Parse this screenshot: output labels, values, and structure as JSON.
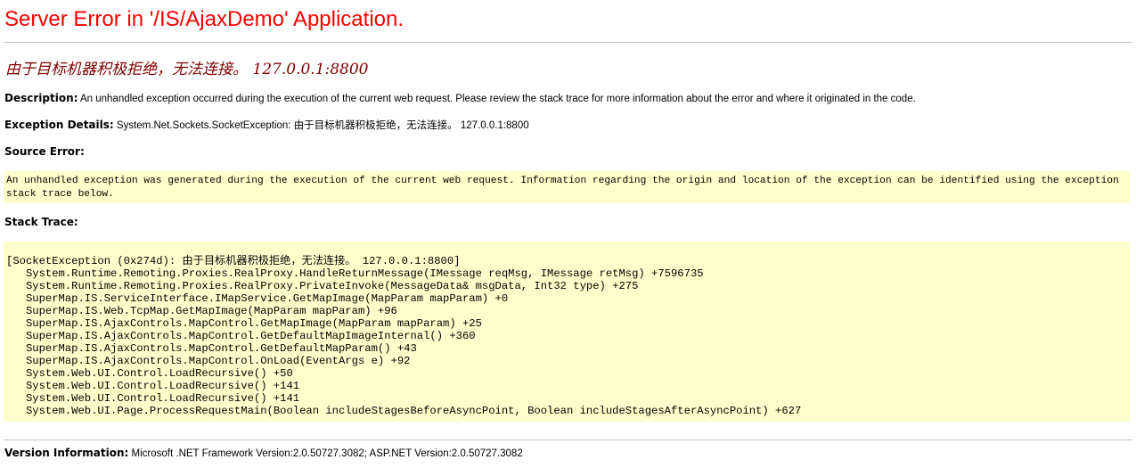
{
  "page": {
    "title": "Server Error in '/IS/AjaxDemo' Application.",
    "error_message": "由于目标机器积极拒绝，无法连接。 127.0.0.1:8800"
  },
  "description": {
    "label": "Description:",
    "text": "An unhandled exception occurred during the execution of the current web request. Please review the stack trace for more information about the error and where it originated in the code."
  },
  "exception_details": {
    "label": "Exception Details:",
    "text": "System.Net.Sockets.SocketException: 由于目标机器积极拒绝，无法连接。 127.0.0.1:8800"
  },
  "source_error": {
    "label": "Source Error:",
    "text": "An unhandled exception was generated during the execution of the current web request. Information regarding the origin and location of the exception can be identified using the exception stack trace below."
  },
  "stack_trace": {
    "label": "Stack Trace:",
    "text": "[SocketException (0x274d): 由于目标机器积极拒绝，无法连接。 127.0.0.1:8800]\n   System.Runtime.Remoting.Proxies.RealProxy.HandleReturnMessage(IMessage reqMsg, IMessage retMsg) +7596735\n   System.Runtime.Remoting.Proxies.RealProxy.PrivateInvoke(MessageData& msgData, Int32 type) +275\n   SuperMap.IS.ServiceInterface.IMapService.GetMapImage(MapParam mapParam) +0\n   SuperMap.IS.Web.TcpMap.GetMapImage(MapParam mapParam) +96\n   SuperMap.IS.AjaxControls.MapControl.GetMapImage(MapParam mapParam) +25\n   SuperMap.IS.AjaxControls.MapControl.GetDefaultMapImageInternal() +360\n   SuperMap.IS.AjaxControls.MapControl.GetDefaultMapParam() +43\n   SuperMap.IS.AjaxControls.MapControl.OnLoad(EventArgs e) +92\n   System.Web.UI.Control.LoadRecursive() +50\n   System.Web.UI.Control.LoadRecursive() +141\n   System.Web.UI.Control.LoadRecursive() +141\n   System.Web.UI.Page.ProcessRequestMain(Boolean includeStagesBeforeAsyncPoint, Boolean includeStagesAfterAsyncPoint) +627"
  },
  "version_info": {
    "label": "Version Information:",
    "text": "Microsoft .NET Framework Version:2.0.50727.3082; ASP.NET Version:2.0.50727.3082"
  }
}
